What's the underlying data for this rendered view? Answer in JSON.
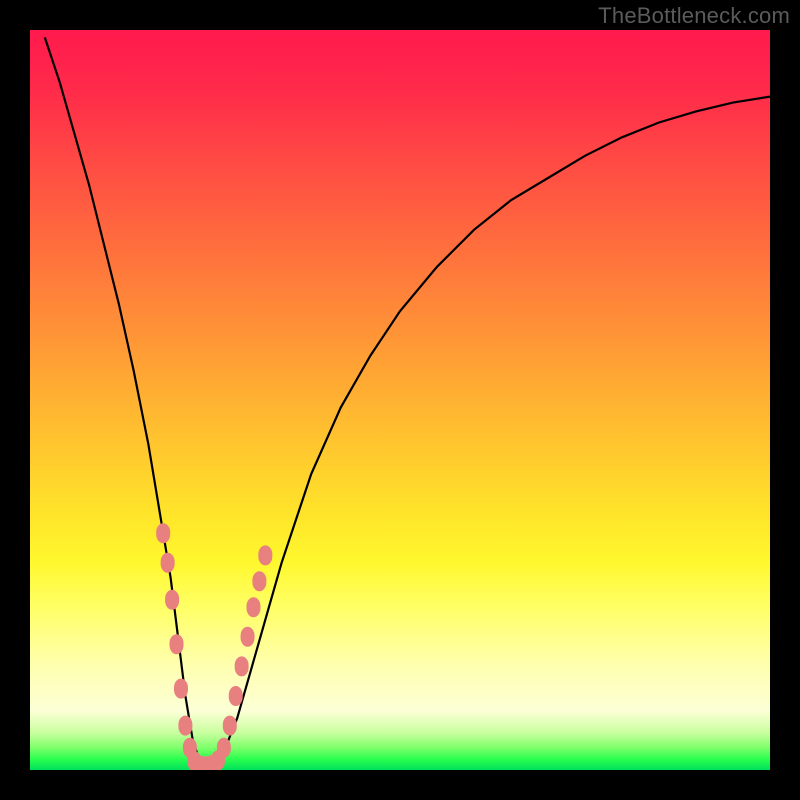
{
  "watermark": "TheBottleneck.com",
  "colors": {
    "frame": "#000000",
    "curve": "#000000",
    "marker_fill": "#e98080",
    "marker_stroke": "#c26a6a"
  },
  "chart_data": {
    "type": "line",
    "title": "",
    "xlabel": "",
    "ylabel": "",
    "xlim": [
      0,
      100
    ],
    "ylim": [
      0,
      100
    ],
    "grid": false,
    "legend": false,
    "series": [
      {
        "name": "bottleneck-curve",
        "x": [
          2,
          4,
          6,
          8,
          10,
          12,
          14,
          16,
          18,
          19,
          20,
          21,
          22,
          23,
          24,
          25,
          26,
          28,
          30,
          32,
          34,
          36,
          38,
          42,
          46,
          50,
          55,
          60,
          65,
          70,
          75,
          80,
          85,
          90,
          95,
          100
        ],
        "values": [
          99,
          93,
          86,
          79,
          71,
          63,
          54,
          44,
          32,
          26,
          18,
          10,
          4,
          1,
          0.5,
          0.8,
          2,
          7,
          14,
          21,
          28,
          34,
          40,
          49,
          56,
          62,
          68,
          73,
          77,
          80,
          83,
          85.5,
          87.5,
          89,
          90.2,
          91
        ]
      }
    ],
    "markers": {
      "name": "highlight-points",
      "x": [
        18.0,
        18.6,
        19.2,
        19.8,
        20.4,
        21.0,
        21.6,
        22.2,
        23.0,
        23.8,
        24.6,
        25.4,
        26.2,
        27.0,
        27.8,
        28.6,
        29.4,
        30.2,
        31.0,
        31.8
      ],
      "values": [
        32.0,
        28.0,
        23.0,
        17.0,
        11.0,
        6.0,
        3.0,
        1.2,
        0.6,
        0.5,
        0.7,
        1.3,
        3.0,
        6.0,
        10.0,
        14.0,
        18.0,
        22.0,
        25.5,
        29.0
      ]
    }
  }
}
